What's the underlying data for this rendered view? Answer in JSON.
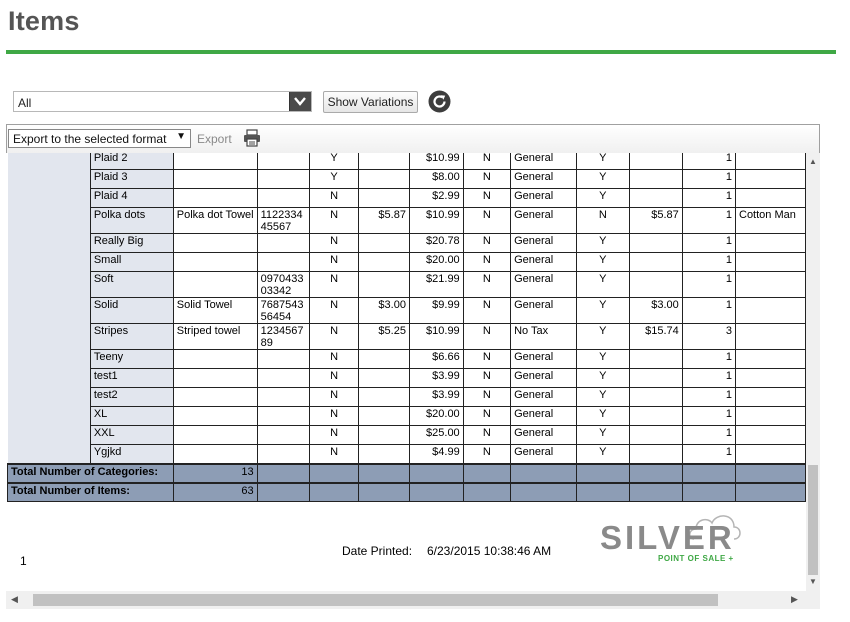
{
  "page": {
    "title": "Items"
  },
  "filter": {
    "selected": "All",
    "show_variations_label": "Show Variations"
  },
  "toolbar": {
    "export_format": "Export to the selected format",
    "export_label": "Export"
  },
  "report": {
    "rows": [
      {
        "name": "Plaid 2",
        "desc": "",
        "code": "",
        "flag1": "Y",
        "cost": "",
        "price": "$10.99",
        "flag2": "N",
        "tax": "General",
        "flag3": "Y",
        "cost2": "",
        "qty": "1",
        "extra": ""
      },
      {
        "name": "Plaid 3",
        "desc": "",
        "code": "",
        "flag1": "Y",
        "cost": "",
        "price": "$8.00",
        "flag2": "N",
        "tax": "General",
        "flag3": "Y",
        "cost2": "",
        "qty": "1",
        "extra": ""
      },
      {
        "name": "Plaid 4",
        "desc": "",
        "code": "",
        "flag1": "N",
        "cost": "",
        "price": "$2.99",
        "flag2": "N",
        "tax": "General",
        "flag3": "Y",
        "cost2": "",
        "qty": "1",
        "extra": ""
      },
      {
        "name": "Polka dots",
        "desc": "Polka dot Towel",
        "code": "112233445567",
        "flag1": "N",
        "cost": "$5.87",
        "price": "$10.99",
        "flag2": "N",
        "tax": "General",
        "flag3": "N",
        "cost2": "$5.87",
        "qty": "1",
        "extra": "Cotton Man"
      },
      {
        "name": "Really Big",
        "desc": "",
        "code": "",
        "flag1": "N",
        "cost": "",
        "price": "$20.78",
        "flag2": "N",
        "tax": "General",
        "flag3": "Y",
        "cost2": "",
        "qty": "1",
        "extra": ""
      },
      {
        "name": "Small",
        "desc": "",
        "code": "",
        "flag1": "N",
        "cost": "",
        "price": "$20.00",
        "flag2": "N",
        "tax": "General",
        "flag3": "Y",
        "cost2": "",
        "qty": "1",
        "extra": ""
      },
      {
        "name": "Soft",
        "desc": "",
        "code": "097043303342",
        "flag1": "N",
        "cost": "",
        "price": "$21.99",
        "flag2": "N",
        "tax": "General",
        "flag3": "Y",
        "cost2": "",
        "qty": "1",
        "extra": ""
      },
      {
        "name": "Solid",
        "desc": "Solid Towel",
        "code": "768754356454",
        "flag1": "N",
        "cost": "$3.00",
        "price": "$9.99",
        "flag2": "N",
        "tax": "General",
        "flag3": "Y",
        "cost2": "$3.00",
        "qty": "1",
        "extra": ""
      },
      {
        "name": "Stripes",
        "desc": "Striped towel",
        "code": "123456789",
        "flag1": "N",
        "cost": "$5.25",
        "price": "$10.99",
        "flag2": "N",
        "tax": "No Tax",
        "flag3": "Y",
        "cost2": "$15.74",
        "qty": "3",
        "extra": ""
      },
      {
        "name": "Teeny",
        "desc": "",
        "code": "",
        "flag1": "N",
        "cost": "",
        "price": "$6.66",
        "flag2": "N",
        "tax": "General",
        "flag3": "Y",
        "cost2": "",
        "qty": "1",
        "extra": ""
      },
      {
        "name": "test1",
        "desc": "",
        "code": "",
        "flag1": "N",
        "cost": "",
        "price": "$3.99",
        "flag2": "N",
        "tax": "General",
        "flag3": "Y",
        "cost2": "",
        "qty": "1",
        "extra": ""
      },
      {
        "name": "test2",
        "desc": "",
        "code": "",
        "flag1": "N",
        "cost": "",
        "price": "$3.99",
        "flag2": "N",
        "tax": "General",
        "flag3": "Y",
        "cost2": "",
        "qty": "1",
        "extra": ""
      },
      {
        "name": "XL",
        "desc": "",
        "code": "",
        "flag1": "N",
        "cost": "",
        "price": "$20.00",
        "flag2": "N",
        "tax": "General",
        "flag3": "Y",
        "cost2": "",
        "qty": "1",
        "extra": ""
      },
      {
        "name": "XXL",
        "desc": "",
        "code": "",
        "flag1": "N",
        "cost": "",
        "price": "$25.00",
        "flag2": "N",
        "tax": "General",
        "flag3": "Y",
        "cost2": "",
        "qty": "1",
        "extra": ""
      },
      {
        "name": "Ygjkd",
        "desc": "",
        "code": "",
        "flag1": "N",
        "cost": "",
        "price": "$4.99",
        "flag2": "N",
        "tax": "General",
        "flag3": "Y",
        "cost2": "",
        "qty": "1",
        "extra": ""
      }
    ],
    "totals": {
      "categories_label": "Total Number of Categories:",
      "categories_value": "13",
      "items_label": "Total Number of Items:",
      "items_value": "63"
    },
    "footer": {
      "page_number": "1",
      "date_label": "Date Printed:",
      "date_value": "6/23/2015 10:38:46 AM"
    },
    "logo": {
      "wordmark": "SILVER",
      "tagline": "POINT OF SALE +"
    }
  },
  "colors": {
    "accent": "#3fa845",
    "total_row": "#8d9db5",
    "name_cell": "#e2e6ee"
  }
}
